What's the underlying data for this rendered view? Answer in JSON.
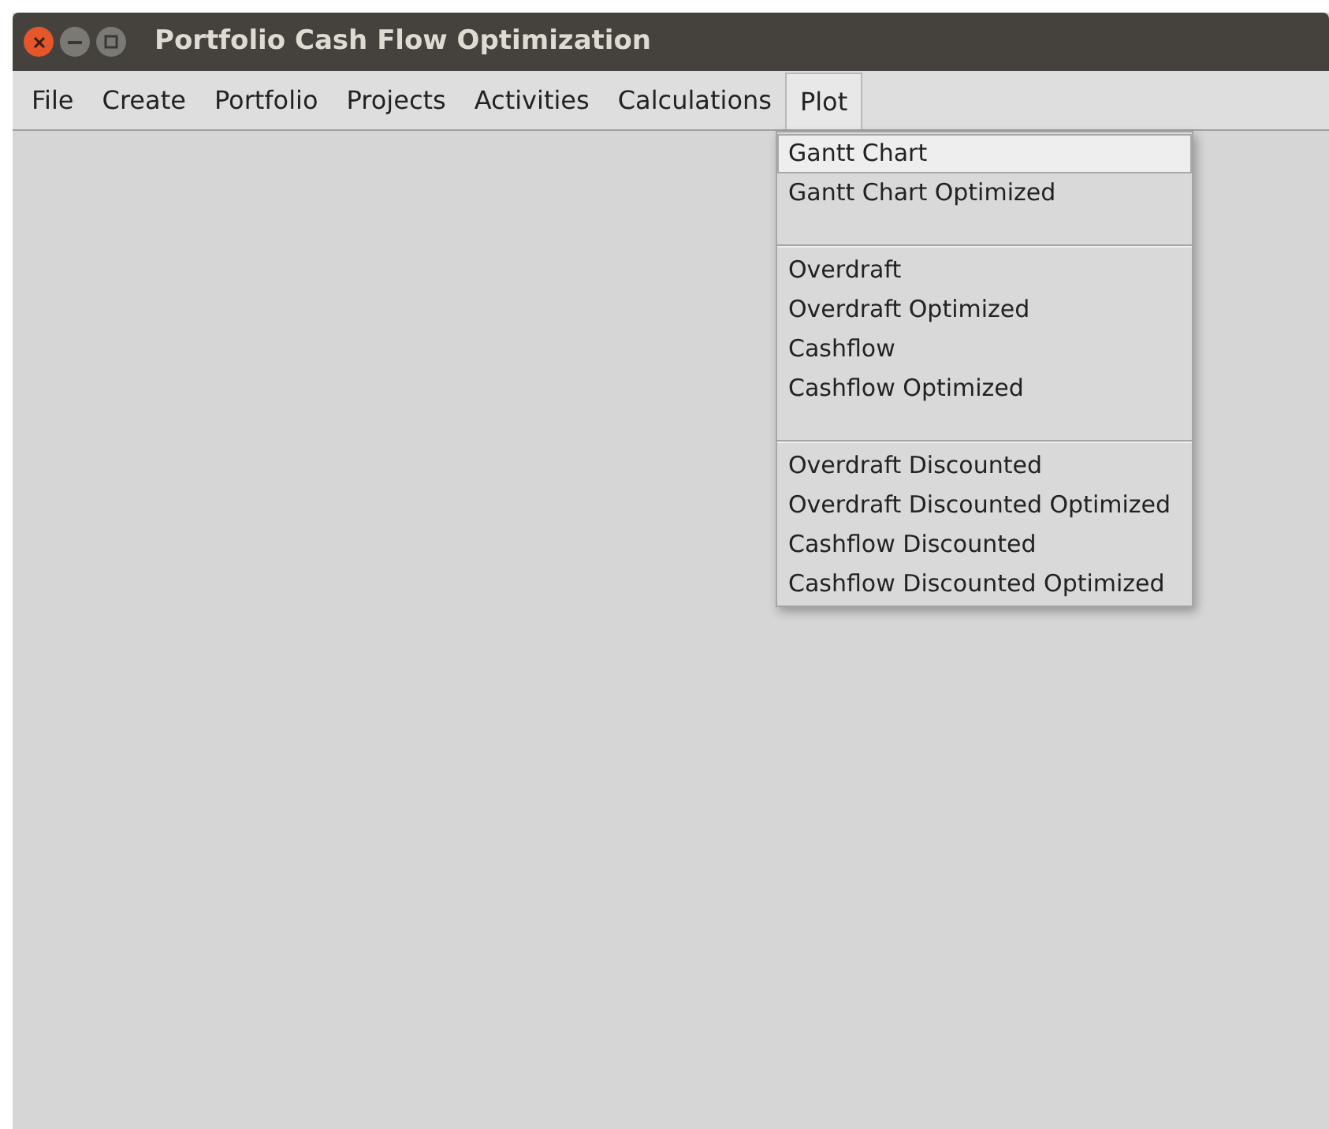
{
  "window": {
    "title": "Portfolio Cash Flow Optimization"
  },
  "menubar": [
    {
      "label": "File",
      "selected": false
    },
    {
      "label": "Create",
      "selected": false
    },
    {
      "label": "Portfolio",
      "selected": false
    },
    {
      "label": "Projects",
      "selected": false
    },
    {
      "label": "Activities",
      "selected": false
    },
    {
      "label": "Calculations",
      "selected": false
    },
    {
      "label": "Plot",
      "selected": true
    }
  ],
  "menu": [
    {
      "kind": "item",
      "label": "Gantt Chart",
      "selected": true
    },
    {
      "kind": "item",
      "label": "Gantt Chart Optimized",
      "selected": false
    },
    {
      "kind": "separator"
    },
    {
      "kind": "item",
      "label": "Overdraft",
      "selected": false
    },
    {
      "kind": "item",
      "label": "Overdraft Optimized",
      "selected": false
    },
    {
      "kind": "item",
      "label": "Cashflow",
      "selected": false
    },
    {
      "kind": "item",
      "label": "Cashflow Optimized",
      "selected": false
    },
    {
      "kind": "separator"
    },
    {
      "kind": "item",
      "label": "Overdraft Discounted",
      "selected": false
    },
    {
      "kind": "item",
      "label": "Overdraft Discounted Optimized",
      "selected": false
    },
    {
      "kind": "item",
      "label": "Cashflow Discounted",
      "selected": false
    },
    {
      "kind": "item",
      "label": "Cashflow Discounted Optimized",
      "selected": false
    }
  ]
}
